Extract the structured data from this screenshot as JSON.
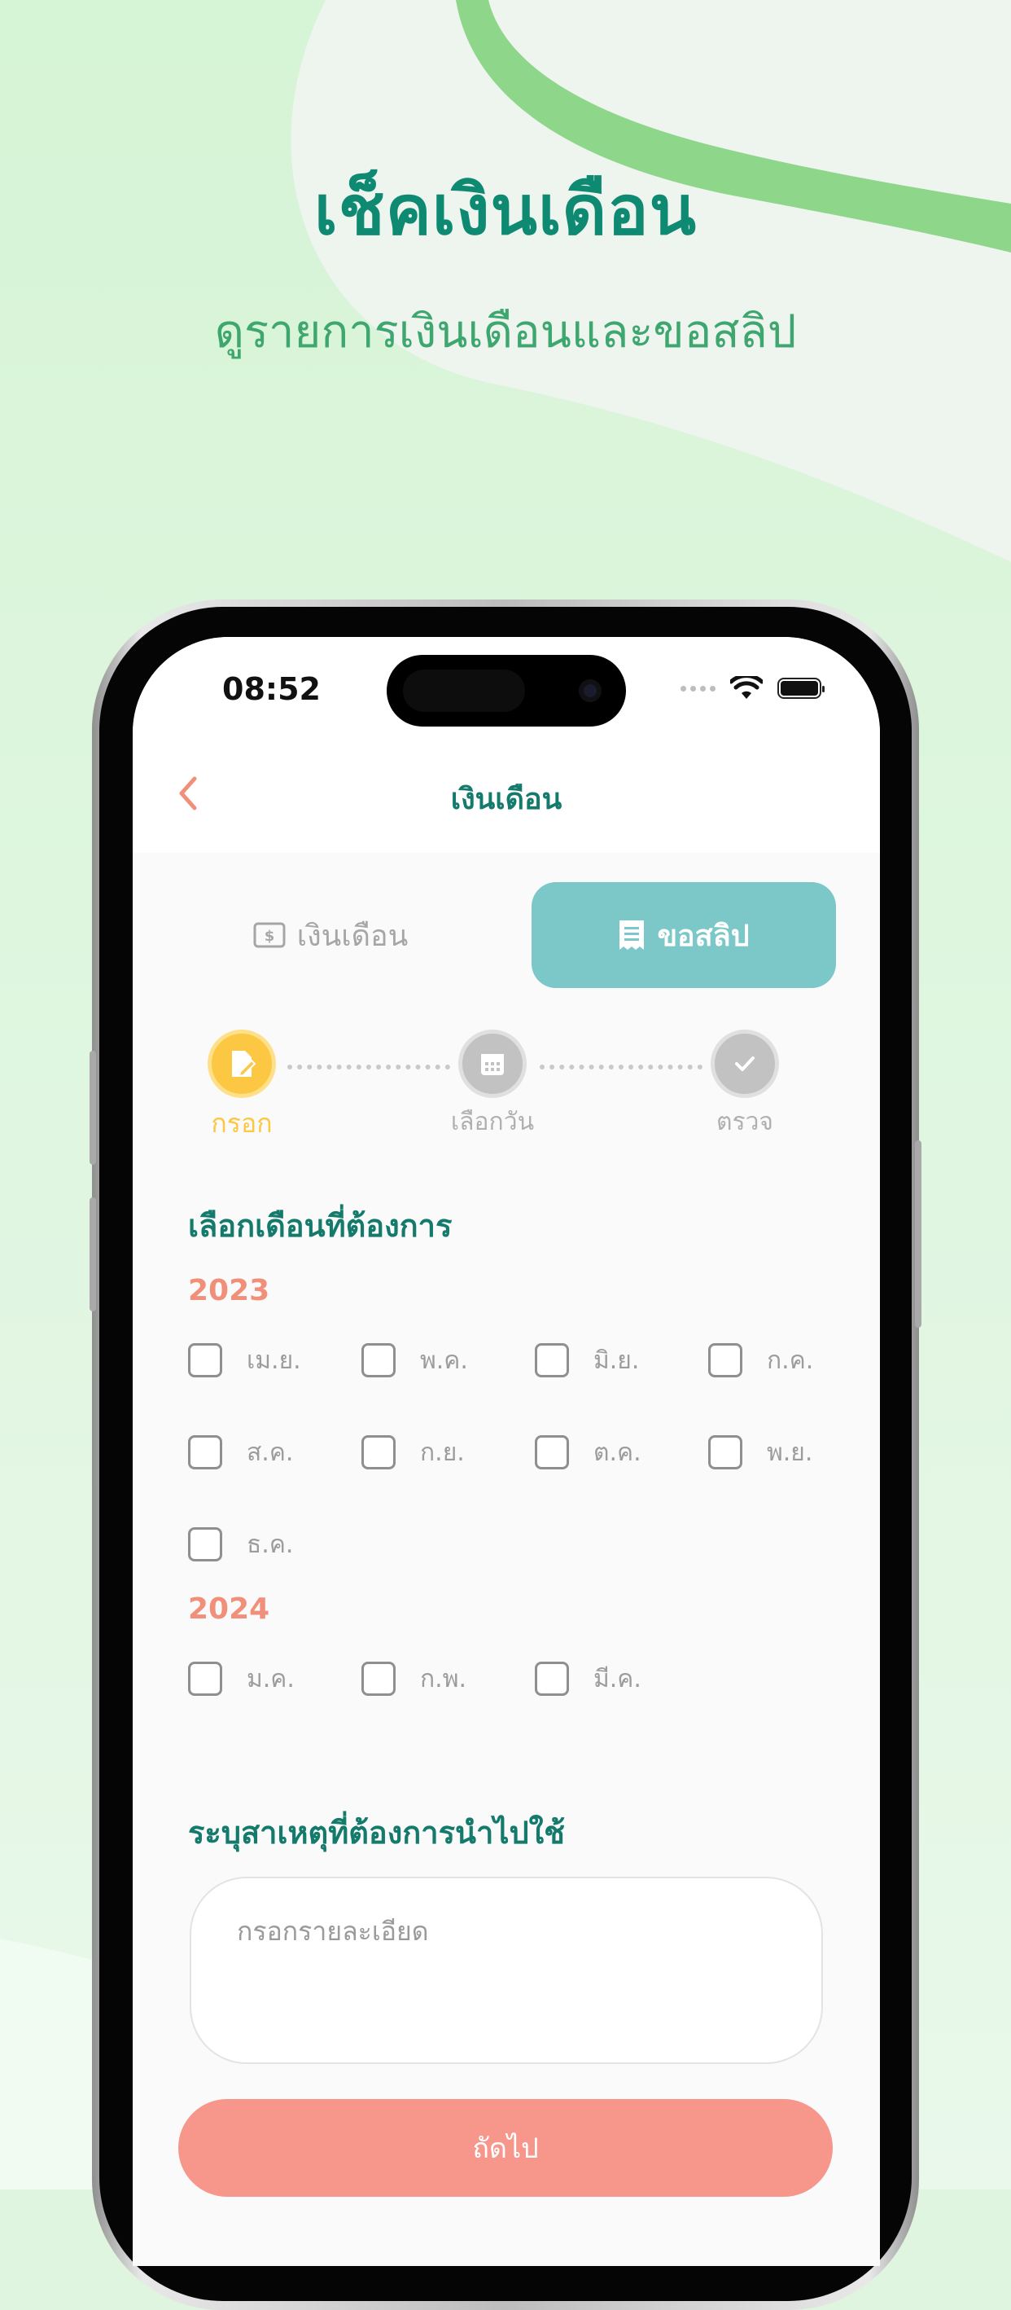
{
  "hero": {
    "title": "เช็คเงินเดือน",
    "subtitle": "ดูรายการเงินเดือนและขอสลิป"
  },
  "status_bar": {
    "time": "08:52"
  },
  "nav": {
    "title": "เงินเดือน",
    "back_icon": "chevron-left-icon"
  },
  "tabs": [
    {
      "label": "เงินเดือน",
      "icon": "money-icon",
      "active": false
    },
    {
      "label": "ขอสลิป",
      "icon": "receipt-icon",
      "active": true
    }
  ],
  "stepper": [
    {
      "label": "กรอก",
      "icon": "edit-icon",
      "state": "active"
    },
    {
      "label": "เลือกวัน",
      "icon": "calendar-icon",
      "state": "pending"
    },
    {
      "label": "ตรวจ",
      "icon": "check-icon",
      "state": "pending"
    }
  ],
  "month_section": {
    "title": "เลือกเดือนที่ต้องการ",
    "years": [
      {
        "year": "2023",
        "months": [
          {
            "label": "เม.ย.",
            "checked": false
          },
          {
            "label": "พ.ค.",
            "checked": false
          },
          {
            "label": "มิ.ย.",
            "checked": false
          },
          {
            "label": "ก.ค.",
            "checked": false
          },
          {
            "label": "ส.ค.",
            "checked": false
          },
          {
            "label": "ก.ย.",
            "checked": false
          },
          {
            "label": "ต.ค.",
            "checked": false
          },
          {
            "label": "พ.ย.",
            "checked": false
          },
          {
            "label": "ธ.ค.",
            "checked": false
          }
        ]
      },
      {
        "year": "2024",
        "months": [
          {
            "label": "ม.ค.",
            "checked": false
          },
          {
            "label": "ก.พ.",
            "checked": false
          },
          {
            "label": "มี.ค.",
            "checked": false
          }
        ]
      }
    ]
  },
  "reason_section": {
    "title": "ระบุสาเหตุที่ต้องการนำไปใช้",
    "placeholder": "กรอกรายละเอียด"
  },
  "next_button": {
    "label": "ถัดไป"
  },
  "colors": {
    "primary_teal": "#137a6c",
    "tab_active": "#7cc7c7",
    "step_active": "#fcc844",
    "year_accent": "#f0907a",
    "button": "#f7968a"
  }
}
